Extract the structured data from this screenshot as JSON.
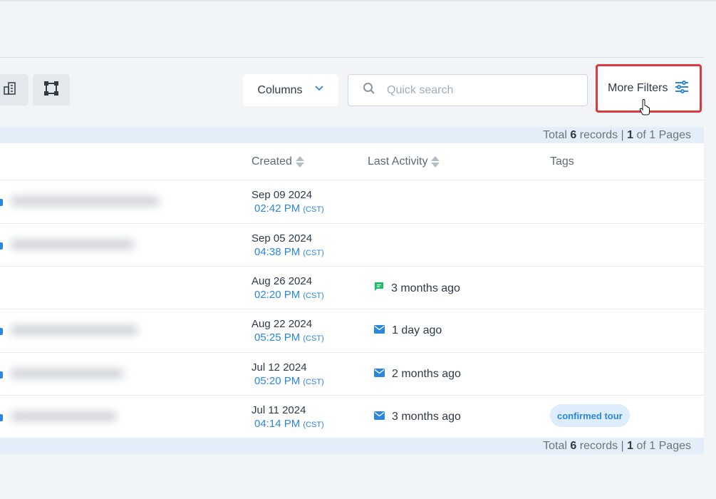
{
  "toolbar": {
    "columns_label": "Columns",
    "search_placeholder": "Quick search",
    "more_filters_label": "More Filters"
  },
  "pager": {
    "prefix": "Total",
    "records": "6",
    "records_label": "records |",
    "page": "1",
    "of_label": "of 1 Pages"
  },
  "table": {
    "headers": {
      "created": "Created",
      "last_activity": "Last Activity",
      "tags": "Tags"
    },
    "rows": [
      {
        "date": "Sep 09 2024",
        "time": "02:42 PM",
        "tz": "(CST)",
        "activity": "",
        "activity_icon": "",
        "tag": ""
      },
      {
        "date": "Sep 05 2024",
        "time": "04:38 PM",
        "tz": "(CST)",
        "activity": "",
        "activity_icon": "",
        "tag": ""
      },
      {
        "date": "Aug 26 2024",
        "time": "02:20 PM",
        "tz": "(CST)",
        "activity": "3 months ago",
        "activity_icon": "chat-icon",
        "tag": ""
      },
      {
        "date": "Aug 22 2024",
        "time": "05:25 PM",
        "tz": "(CST)",
        "activity": "1 day ago",
        "activity_icon": "email-icon",
        "tag": ""
      },
      {
        "date": "Jul 12 2024",
        "time": "05:20 PM",
        "tz": "(CST)",
        "activity": "2 months ago",
        "activity_icon": "email-icon",
        "tag": ""
      },
      {
        "date": "Jul 11 2024",
        "time": "04:14 PM",
        "tz": "(CST)",
        "activity": "3 months ago",
        "activity_icon": "email-icon",
        "tag": "confirmed tour"
      }
    ]
  },
  "colors": {
    "accent": "#2b86e0",
    "highlight": "#d93a3f",
    "chat_icon": "#1fbf6a"
  }
}
